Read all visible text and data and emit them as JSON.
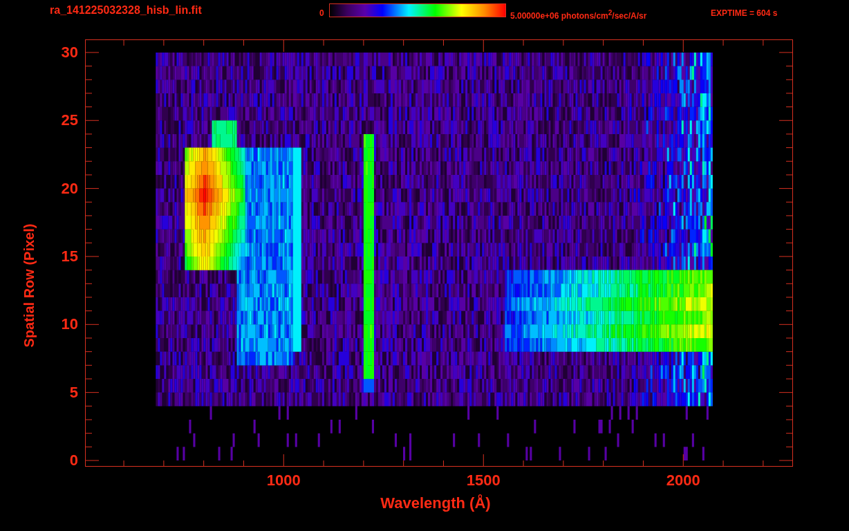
{
  "header": {
    "title": "ra_141225032328_hisb_lin.fit",
    "colorbar": {
      "min_label": "0",
      "max_label": "5.00000e+06 photons/cm$^{2}$/sec/A/sr"
    },
    "exposure": "EXPTIME = 604 s"
  },
  "plot": {
    "ylabel": "Spatial Row (Pixel)",
    "xlabel": "Wavelength (Å)",
    "x_tick_labels": [
      "1000",
      "1500",
      "2000"
    ],
    "y_tick_labels": [
      "30",
      "25",
      "20",
      "15",
      "10",
      "5",
      "0"
    ]
  }
}
